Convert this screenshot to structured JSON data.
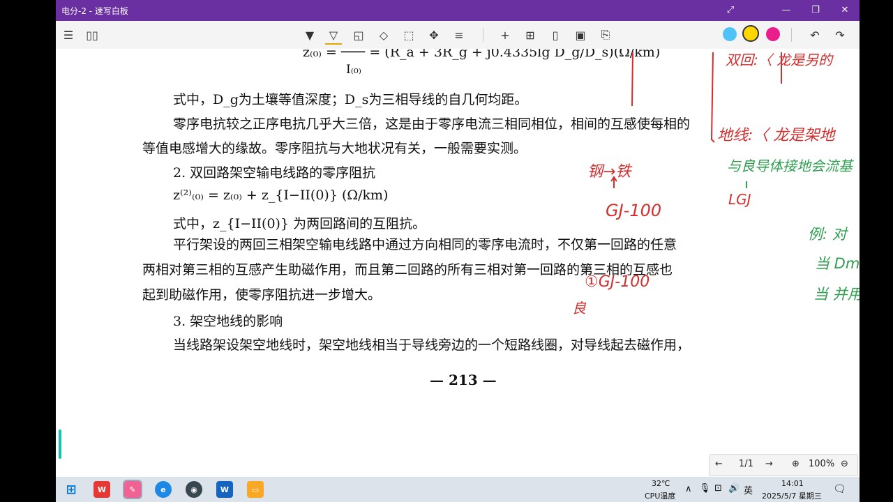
{
  "window": {
    "title": "电分-2 - 速写白板"
  },
  "toolbar": {
    "colors": {
      "cyan": "#4fc3f7",
      "yellow": "#ffd600",
      "magenta": "#e91e8c"
    }
  },
  "document": {
    "formula_top": "z₍₀₎ = ─── = (R_a + 3R_g + j0.4335lg D_g/D_s)(Ω/km)",
    "formula_top_denominator": "I₍₀₎",
    "line1": "式中，D_g为土壤等值深度；D_s为三相导线的自几何均距。",
    "line2": "零序电抗较之正序电抗几乎大三倍，这是由于零序电流三相同相位，相间的互感使每相的",
    "line3": "等值电感增大的缘故。零序阻抗与大地状况有关，一般需要实测。",
    "heading2": "2. 双回路架空输电线路的零序阻抗",
    "formula2": "z⁽²⁾₍₀₎ = z₍₀₎ + z_{I−II(0)} (Ω/km)",
    "line4": "式中，z_{I−II(0)} 为两回路间的互阻抗。",
    "line5": "平行架设的两回三相架空输电线路中通过方向相同的零序电流时，不仅第一回路的任意",
    "line6": "两相对第三相的互感产生助磁作用，而且第二回路的所有三相对第一回路的第三相的互感也",
    "line7": "起到助磁作用，使零序阻抗进一步增大。",
    "heading3": "3. 架空地线的影响",
    "line8": "当线路架设架空地线时，架空地线相当于导线旁边的一个短路线圈，对导线起去磁作用，",
    "page_number": "— 213 —"
  },
  "annotations": {
    "red": [
      "钢→铁",
      "GJ-100",
      "①GJ-100",
      "良",
      "地线:〈 龙是架地",
      "双回:〈 龙是另的"
    ],
    "green": [
      "与良导体接地会流基",
      "LGJ",
      "例: 对",
      "当 Dm",
      "当 并用"
    ]
  },
  "pagenav": {
    "page": "1/1",
    "zoom": "100%"
  },
  "taskbar": {
    "temp": "32℃",
    "temp_label": "CPU温度",
    "ime": "英",
    "time": "14:01",
    "date": "2025/5/7 星期三"
  }
}
